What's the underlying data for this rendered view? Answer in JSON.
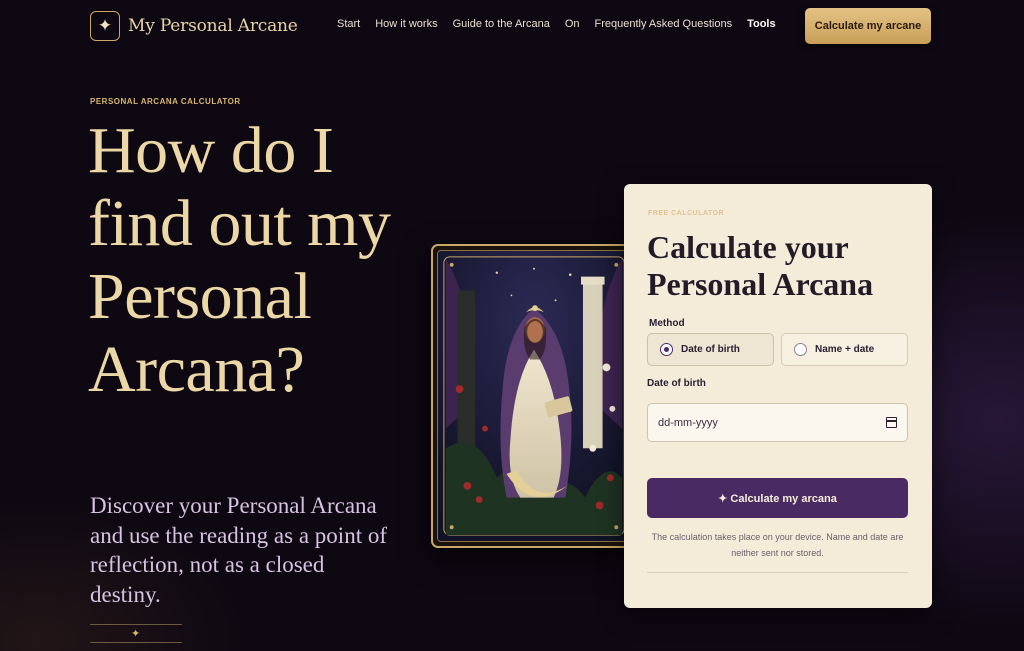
{
  "header": {
    "logo_glyph": "✦",
    "logo_text": "My Personal Arcane",
    "nav": [
      {
        "label": "Start",
        "bold": false
      },
      {
        "label": "How it works",
        "bold": false
      },
      {
        "label": "Guide to the Arcana",
        "bold": false
      },
      {
        "label": "On",
        "bold": false
      },
      {
        "label": "Frequently Asked Questions",
        "bold": false
      },
      {
        "label": "Tools",
        "bold": true
      }
    ],
    "cta_label": "Calculate my arcane"
  },
  "hero": {
    "eyebrow": "PERSONAL ARCANA CALCULATOR",
    "title": "How do I find out my Personal Arcana?",
    "subtitle": "Discover your Personal Arcana and use the reading as a point of reflection, not as a closed destiny.",
    "divider_glyph": "✦"
  },
  "card_image": {
    "icon": "tarot-card-illustration"
  },
  "calculator": {
    "eyebrow": "FREE CALCULATOR",
    "title": "Calculate your Personal Arcana",
    "method_label": "Method",
    "methods": [
      {
        "label": "Date of birth",
        "selected": true
      },
      {
        "label": "Name + date",
        "selected": false
      }
    ],
    "date_label": "Date of birth",
    "date_placeholder": "dd-mm-yyyy",
    "submit_label": "✦ Calculate my arcana",
    "note": "The calculation takes place on your device. Name and date are neither sent nor stored."
  },
  "colors": {
    "background": "#0e0812",
    "gold": "#d9b56d",
    "title": "#ecd7a6",
    "subtitle": "#d7c3e2",
    "panel": "#f4ecd9",
    "button": "#4a2a62"
  }
}
